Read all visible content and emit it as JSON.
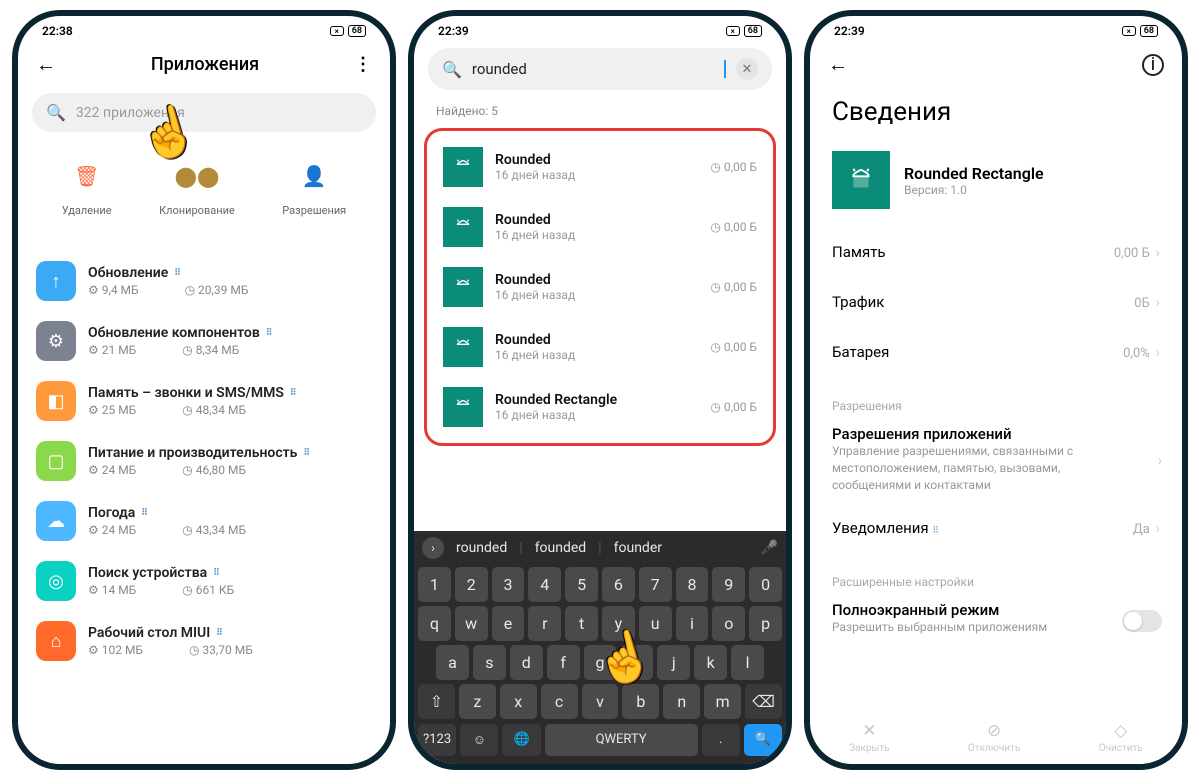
{
  "s1": {
    "time": "22:38",
    "battery": "68",
    "title": "Приложения",
    "searchPlaceholder": "322 приложения",
    "quick": {
      "delete": "Удаление",
      "clone": "Клонирование",
      "perm": "Разрешения"
    },
    "apps": [
      {
        "name": "Обновление",
        "ram": "9,4 МБ",
        "disk": "20,39 МБ",
        "color": "#3ca9f5",
        "glyph": "↑"
      },
      {
        "name": "Обновление компонентов",
        "ram": "21 МБ",
        "disk": "8,34 МБ",
        "color": "#7c8290",
        "glyph": "⚙"
      },
      {
        "name": "Память – звонки и SMS/MMS",
        "ram": "25 МБ",
        "disk": "48,34 МБ",
        "color": "#ff9a3c",
        "glyph": "◧"
      },
      {
        "name": "Питание и производительность",
        "ram": "24 МБ",
        "disk": "46,80 МБ",
        "color": "#8bd94a",
        "glyph": "▢"
      },
      {
        "name": "Погода",
        "ram": "24 МБ",
        "disk": "43,34 МБ",
        "color": "#4db8ff",
        "glyph": "☁"
      },
      {
        "name": "Поиск устройства",
        "ram": "14 МБ",
        "disk": "661 КБ",
        "color": "#0bd1c3",
        "glyph": "◎"
      },
      {
        "name": "Рабочий стол MIUI",
        "ram": "102 МБ",
        "disk": "33,70 МБ",
        "color": "#ff6a2a",
        "glyph": "⌂"
      }
    ]
  },
  "s2": {
    "time": "22:39",
    "battery": "68",
    "query": "rounded",
    "foundLabel": "Найдено: 5",
    "sub": "16 дней назад",
    "size": "0,00 Б",
    "results": [
      "Rounded",
      "Rounded",
      "Rounded",
      "Rounded",
      "Rounded Rectangle"
    ],
    "suggestions": [
      "rounded",
      "founded",
      "founder"
    ],
    "kbLabel": "QWERTY",
    "sym": "?123"
  },
  "s3": {
    "time": "22:39",
    "battery": "68",
    "title": "Сведения",
    "appName": "Rounded Rectangle",
    "version": "Версия: 1.0",
    "rows": {
      "mem": {
        "label": "Память",
        "val": "0,00 Б"
      },
      "traffic": {
        "label": "Трафик",
        "val": "0Б"
      },
      "batt": {
        "label": "Батарея",
        "val": "0,0%"
      }
    },
    "permSection": "Разрешения",
    "permTitle": "Разрешения приложений",
    "permDesc": "Управление разрешениями, связанными с местоположением, памятью, вызовами, сообщениями и контактами",
    "notif": {
      "label": "Уведомления",
      "val": "Да"
    },
    "advSection": "Расширенные настройки",
    "fullTitle": "Полноэкранный режим",
    "fullDesc": "Разрешить выбранным приложениям",
    "actions": {
      "close": "Закрыть",
      "disable": "Отключить",
      "clear": "Очистить"
    }
  }
}
